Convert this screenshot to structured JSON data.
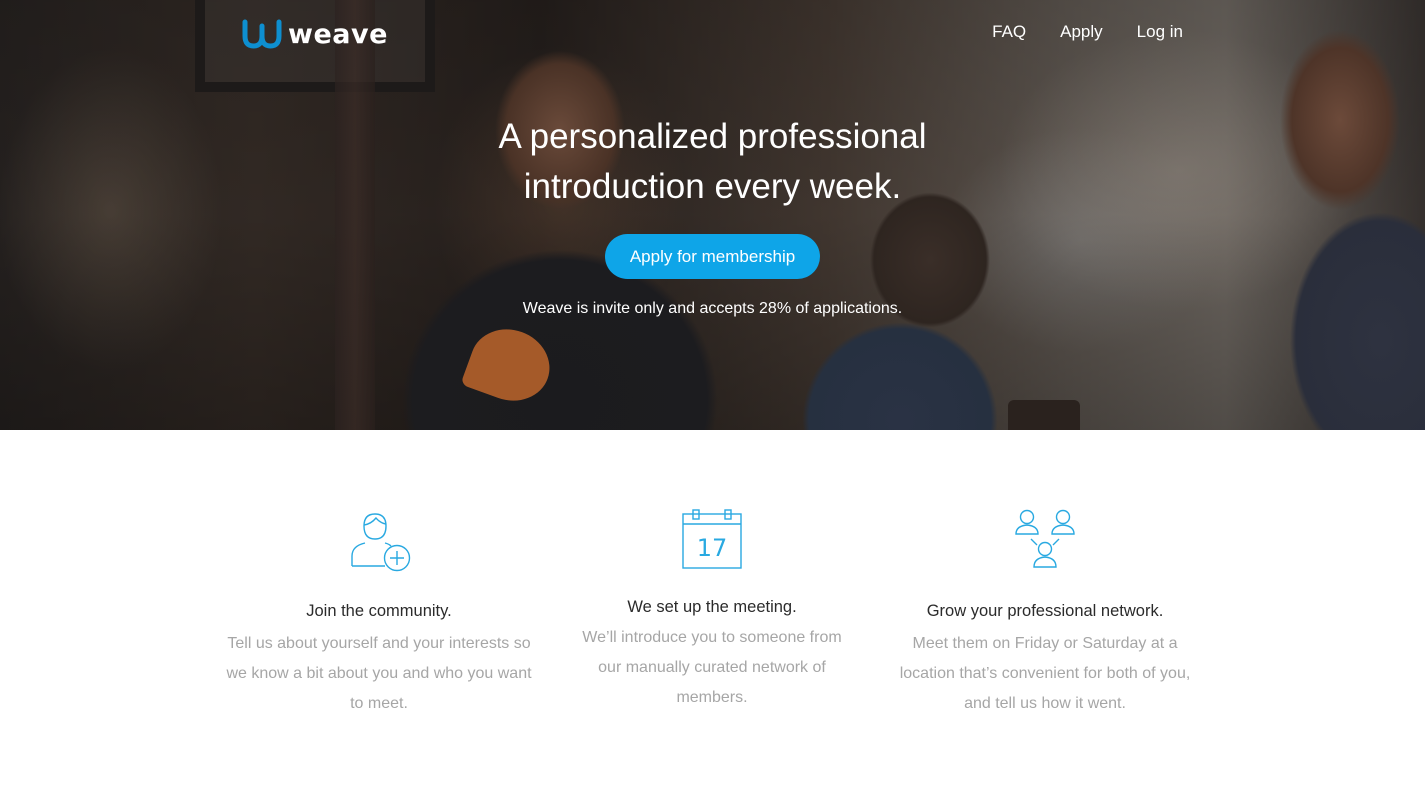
{
  "brand": {
    "name": "weave",
    "accent_color": "#0ea5e8",
    "logo_icon": "weave-w-logo-icon"
  },
  "nav": {
    "faq": "FAQ",
    "apply": "Apply",
    "login": "Log in"
  },
  "hero": {
    "headline_line1": "A personalized professional",
    "headline_line2": "introduction every week.",
    "cta_label": "Apply for membership",
    "note": "Weave is invite only and accepts 28% of applications."
  },
  "features": [
    {
      "icon": "person-add-icon",
      "title": "Join the community.",
      "body": "Tell us about yourself and your interests so we know a bit about you and who you want to meet."
    },
    {
      "icon": "calendar-icon",
      "calendar_day": "17",
      "title": "We set up the meeting.",
      "body": "We’ll introduce you to someone from our manually curated network of members."
    },
    {
      "icon": "network-people-icon",
      "title": "Grow your professional network.",
      "body": "Meet them on Friday or Saturday at a location that’s convenient for both of you, and tell us how it went."
    }
  ]
}
